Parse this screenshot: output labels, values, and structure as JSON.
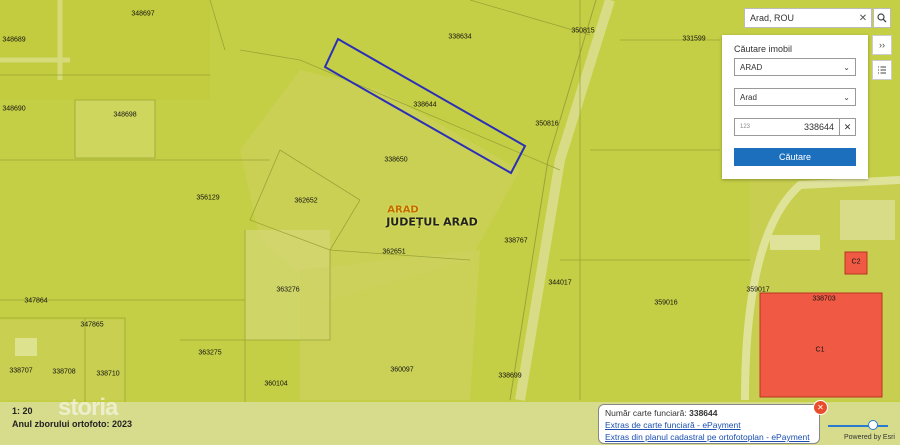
{
  "search": {
    "value": "Arad, ROU"
  },
  "panel": {
    "title": "Căutare imobil",
    "county": "ARAD",
    "uat": "Arad",
    "number_prefix": "123",
    "number": "338644",
    "button": "Căutare"
  },
  "map": {
    "place_labels": {
      "city": "ARAD",
      "county": "JUDEȚUL ARAD"
    },
    "parcels": [
      "348697",
      "348689",
      "348690",
      "348698",
      "338634",
      "350815",
      "331599",
      "338644",
      "350816",
      "338650",
      "356129",
      "362652",
      "338767",
      "362651",
      "363276",
      "347864",
      "347865",
      "344017",
      "359016",
      "359017",
      "338703",
      "363275",
      "338707",
      "338708",
      "338710",
      "360104",
      "360097",
      "338699"
    ],
    "building_labels": [
      "C1",
      "C2"
    ],
    "highlight_color": "#2b2fb8",
    "building_color": "#f05a44"
  },
  "footer": {
    "scale": "1: 20",
    "ortho_year": "Anul zborului ortofoto: 2023",
    "watermark": "storia",
    "powered": "Powered by Esri"
  },
  "popup": {
    "label": "Număr carte funciară:",
    "value": "338644",
    "link1": "Extras de carte funciară - ePayment",
    "link2": "Extras din planul cadastral pe ortofotoplan - ePayment"
  }
}
